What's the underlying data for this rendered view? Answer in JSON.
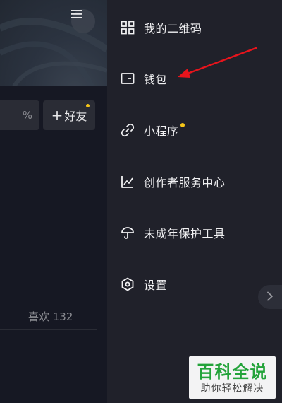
{
  "profile": {
    "percent_text": "%",
    "add_friend": {
      "plus": "+",
      "label": "好友"
    },
    "likes": "喜欢 132"
  },
  "drawer": {
    "items": [
      {
        "id": "qrcode",
        "label": "我的二维码",
        "icon": "qr-code-icon"
      },
      {
        "id": "wallet",
        "label": "钱包",
        "icon": "wallet-icon"
      },
      {
        "id": "mini-program",
        "label": "小程序",
        "icon": "link-icon",
        "dot": true
      },
      {
        "id": "creator-center",
        "label": "创作者服务中心",
        "icon": "chart-icon"
      },
      {
        "id": "minor-protection",
        "label": "未成年保护工具",
        "icon": "umbrella-icon"
      },
      {
        "id": "settings",
        "label": "设置",
        "icon": "hexagon-settings-icon"
      }
    ]
  },
  "watermark": {
    "title": "百科全说",
    "subtitle": "助你轻松解决"
  },
  "colors": {
    "background": "#161823",
    "drawer": "#20212a",
    "dot": "#f5c518",
    "annotation": "#e8141c",
    "watermark_green": "#23a33a"
  }
}
